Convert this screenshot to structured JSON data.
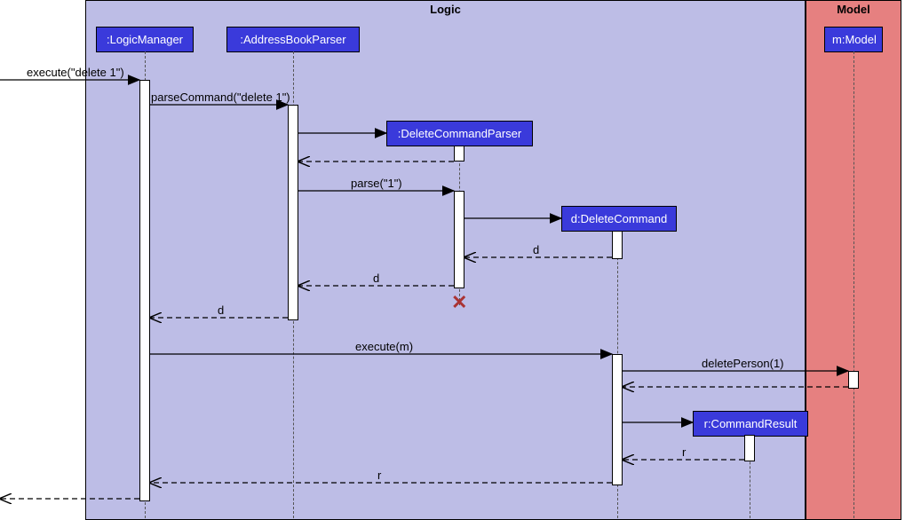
{
  "frames": {
    "logic": "Logic",
    "model": "Model"
  },
  "participants": {
    "logicManager": ":LogicManager",
    "addressBookParser": ":AddressBookParser",
    "deleteCommandParser": ":DeleteCommandParser",
    "deleteCommand": "d:DeleteCommand",
    "commandResult": "r:CommandResult",
    "model": "m:Model"
  },
  "messages": {
    "execute_entry": "execute(\"delete 1\")",
    "parseCommand": "parseCommand(\"delete 1\")",
    "parse": "parse(\"1\")",
    "d1": "d",
    "d2": "d",
    "d3": "d",
    "execute_m": "execute(m)",
    "deletePerson": "deletePerson(1)",
    "r1": "r",
    "r2": "r"
  }
}
